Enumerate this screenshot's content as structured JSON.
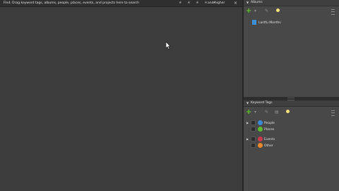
{
  "search_bar": {
    "instructions": "Find: Drag keyword tags, albums, people, places, events, and projects here to search",
    "rating_stars": "★ ★ ★ ★ ★",
    "rating_suffix": "and higher",
    "close": "×"
  },
  "albums": {
    "title": "Albums",
    "items": [
      {
        "label": "Lastfu Months",
        "color": "#3f8fd6"
      }
    ]
  },
  "keyword_tags": {
    "title": "Keyword Tags",
    "categories": [
      {
        "label": "People",
        "color": "#3d8ad4",
        "expandable": true
      },
      {
        "label": "Places",
        "color": "#5cb82d",
        "expandable": false
      },
      {
        "label": "Events",
        "color": "#c93b4a",
        "expandable": true
      },
      {
        "label": "Other",
        "color": "#e8872b",
        "expandable": false
      }
    ]
  },
  "toolbar": {
    "add": "+",
    "dropdown": "▾"
  }
}
